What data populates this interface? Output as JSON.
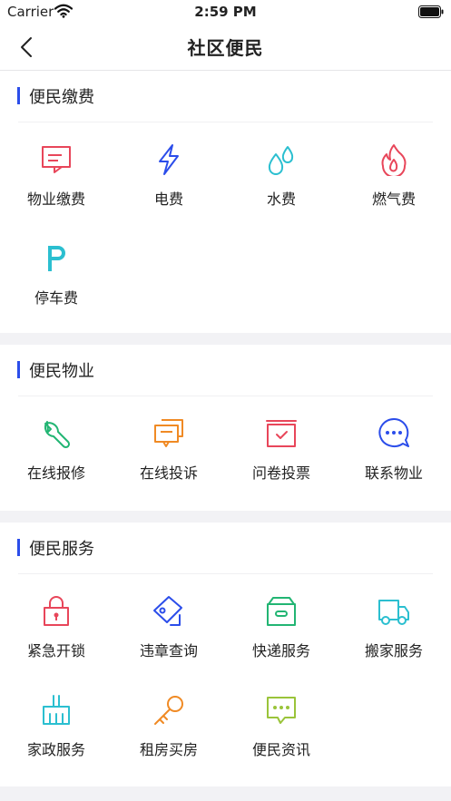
{
  "status": {
    "carrier": "Carrier",
    "time": "2:59 PM"
  },
  "nav": {
    "title": "社区便民"
  },
  "sections": [
    {
      "title": "便民缴费",
      "items": [
        {
          "label": "物业缴费",
          "icon": "property-fee-icon",
          "color": "#e8465a"
        },
        {
          "label": "电费",
          "icon": "lightning-icon",
          "color": "#2b4dea"
        },
        {
          "label": "水费",
          "icon": "water-drop-icon",
          "color": "#2bbfd0"
        },
        {
          "label": "燃气费",
          "icon": "flame-icon",
          "color": "#e8465a"
        },
        {
          "label": "停车费",
          "icon": "parking-icon",
          "color": "#2bbfd0"
        }
      ]
    },
    {
      "title": "便民物业",
      "items": [
        {
          "label": "在线报修",
          "icon": "wrench-icon",
          "color": "#22b573"
        },
        {
          "label": "在线投诉",
          "icon": "chat-bubbles-icon",
          "color": "#f08a24"
        },
        {
          "label": "问卷投票",
          "icon": "ballot-box-icon",
          "color": "#e8465a"
        },
        {
          "label": "联系物业",
          "icon": "message-icon",
          "color": "#2b4dea"
        }
      ]
    },
    {
      "title": "便民服务",
      "items": [
        {
          "label": "紧急开锁",
          "icon": "lock-icon",
          "color": "#e8465a"
        },
        {
          "label": "违章查询",
          "icon": "tag-icon",
          "color": "#2b4dea"
        },
        {
          "label": "快递服务",
          "icon": "package-icon",
          "color": "#22b573"
        },
        {
          "label": "搬家服务",
          "icon": "truck-icon",
          "color": "#2bbfd0"
        },
        {
          "label": "家政服务",
          "icon": "broom-icon",
          "color": "#2bbfd0"
        },
        {
          "label": "租房买房",
          "icon": "key-icon",
          "color": "#f08a24"
        },
        {
          "label": "便民资讯",
          "icon": "news-chat-icon",
          "color": "#9ac43a"
        }
      ]
    }
  ]
}
